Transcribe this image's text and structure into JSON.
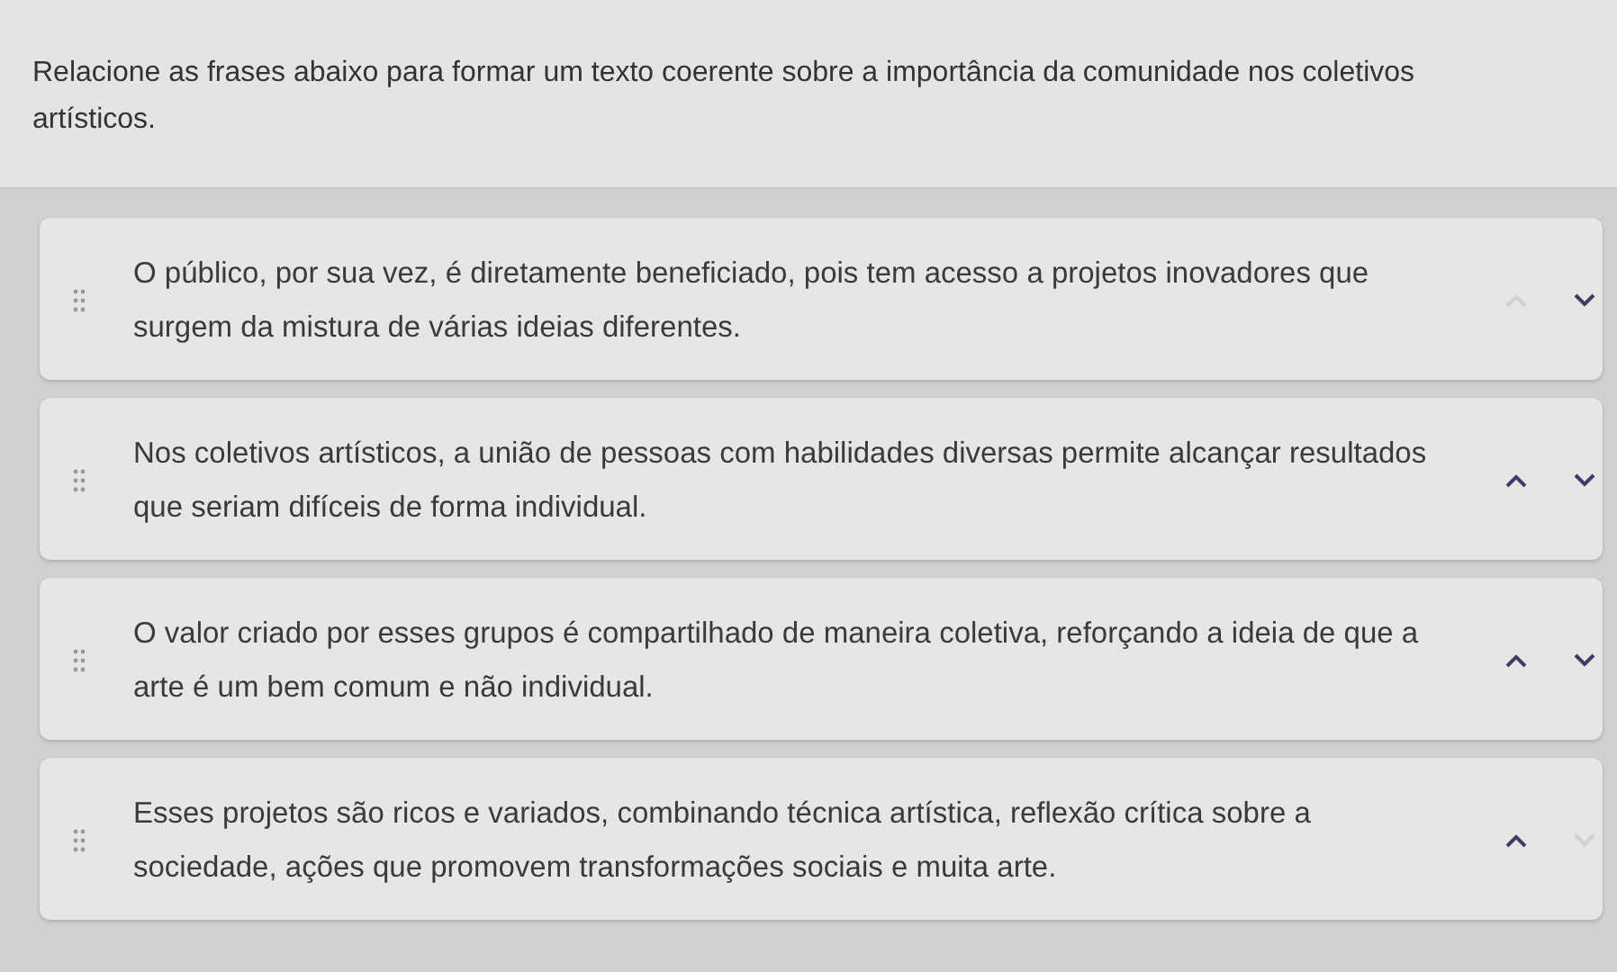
{
  "question": "Relacione as frases abaixo para formar um texto coerente sobre a importância da comunidade nos coletivos artísticos.",
  "items": [
    {
      "text": "O público, por sua vez, é diretamente beneficiado, pois tem acesso a projetos inovadores que surgem da mistura de várias ideias diferentes.",
      "up_disabled": true,
      "down_disabled": false
    },
    {
      "text": "Nos coletivos artísticos, a união de pessoas com habilidades diversas permite alcançar resultados que seriam difíceis de forma individual.",
      "up_disabled": false,
      "down_disabled": false
    },
    {
      "text": "O valor criado por esses grupos é compartilhado de maneira coletiva, reforçando a ideia de que a arte é um bem comum e não individual.",
      "up_disabled": false,
      "down_disabled": false
    },
    {
      "text": "Esses projetos são ricos e variados, combinando técnica artística, reflexão crítica sobre a sociedade, ações que promovem transformações sociais e muita arte.",
      "up_disabled": false,
      "down_disabled": true
    }
  ]
}
